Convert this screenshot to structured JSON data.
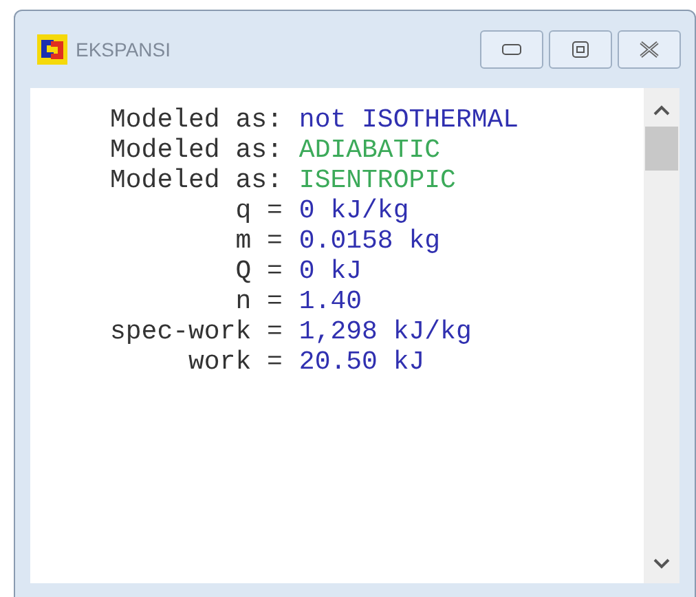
{
  "window": {
    "title": "EKSPANSI"
  },
  "lines": [
    {
      "label": "Modeled as:",
      "value": "not ISOTHERMAL",
      "color": "#3030b0"
    },
    {
      "label": "Modeled as:",
      "value": "ADIABATIC",
      "color": "#3caa5a"
    },
    {
      "label": "Modeled as:",
      "value": "ISENTROPIC",
      "color": "#3caa5a"
    },
    {
      "label": "q =",
      "value": "0 kJ/kg",
      "color": "#3030b0"
    },
    {
      "label": "m =",
      "value": "0.0158 kg",
      "color": "#3030b0"
    },
    {
      "label": "Q =",
      "value": "0 kJ",
      "color": "#3030b0"
    },
    {
      "label": "n =",
      "value": "1.40",
      "color": "#3030b0"
    },
    {
      "label": "spec-work =",
      "value": "1,298 kJ/kg",
      "color": "#3030b0"
    },
    {
      "label": "work =",
      "value": "20.50 kJ",
      "color": "#3030b0"
    }
  ]
}
